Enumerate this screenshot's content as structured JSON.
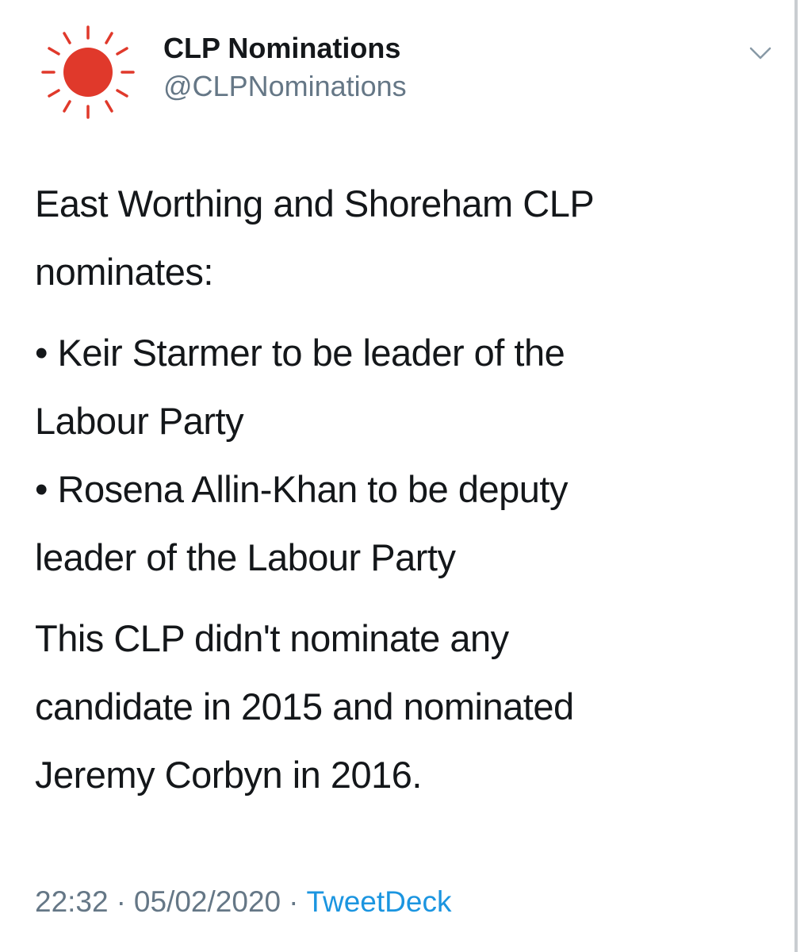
{
  "author": {
    "name": "CLP Nominations",
    "handle": "@CLPNominations",
    "avatar_icon": "sun-icon",
    "avatar_color": "#e0392b"
  },
  "menu_icon": "chevron-down-icon",
  "tweet": {
    "intro_line1": "East Worthing and Shoreham CLP",
    "intro_line2": "nominates:",
    "bullet_char": "•",
    "bullets": [
      {
        "line1": "Keir Starmer to be leader of the",
        "line2": "Labour Party"
      },
      {
        "line1": "Rosena Allin-Khan to be deputy",
        "line2": "leader of the Labour Party"
      }
    ],
    "closing_line1": "This CLP didn't nominate any",
    "closing_line2": "candidate in 2015 and nominated",
    "closing_line3": "Jeremy Corbyn in 2016."
  },
  "meta": {
    "time": "22:32",
    "separator": "·",
    "date": "05/02/2020",
    "source": "TweetDeck",
    "link_color": "#1b95e0"
  }
}
